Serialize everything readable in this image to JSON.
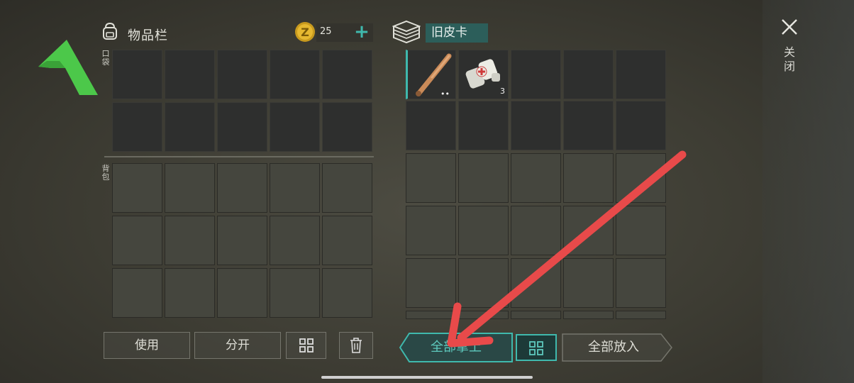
{
  "inventory": {
    "title": "物品栏",
    "pocket_label": "口袋",
    "backpack_label": "背包"
  },
  "currency": {
    "amount": "25",
    "add_label": "+"
  },
  "container": {
    "name": "旧皮卡"
  },
  "close": {
    "label": "关闭"
  },
  "left_buttons": {
    "use": "使用",
    "split": "分开"
  },
  "right_buttons": {
    "take_all": "全部拿上",
    "put_all": "全部放入"
  },
  "loot_items": [
    {
      "icon": "baseball-bat-icon",
      "badge": "••"
    },
    {
      "icon": "bandage-icon",
      "badge": "3"
    }
  ],
  "colors": {
    "accent": "#3fb9ad",
    "annotation_arrow": "#e84a4a",
    "logo": "#4cc84a"
  }
}
